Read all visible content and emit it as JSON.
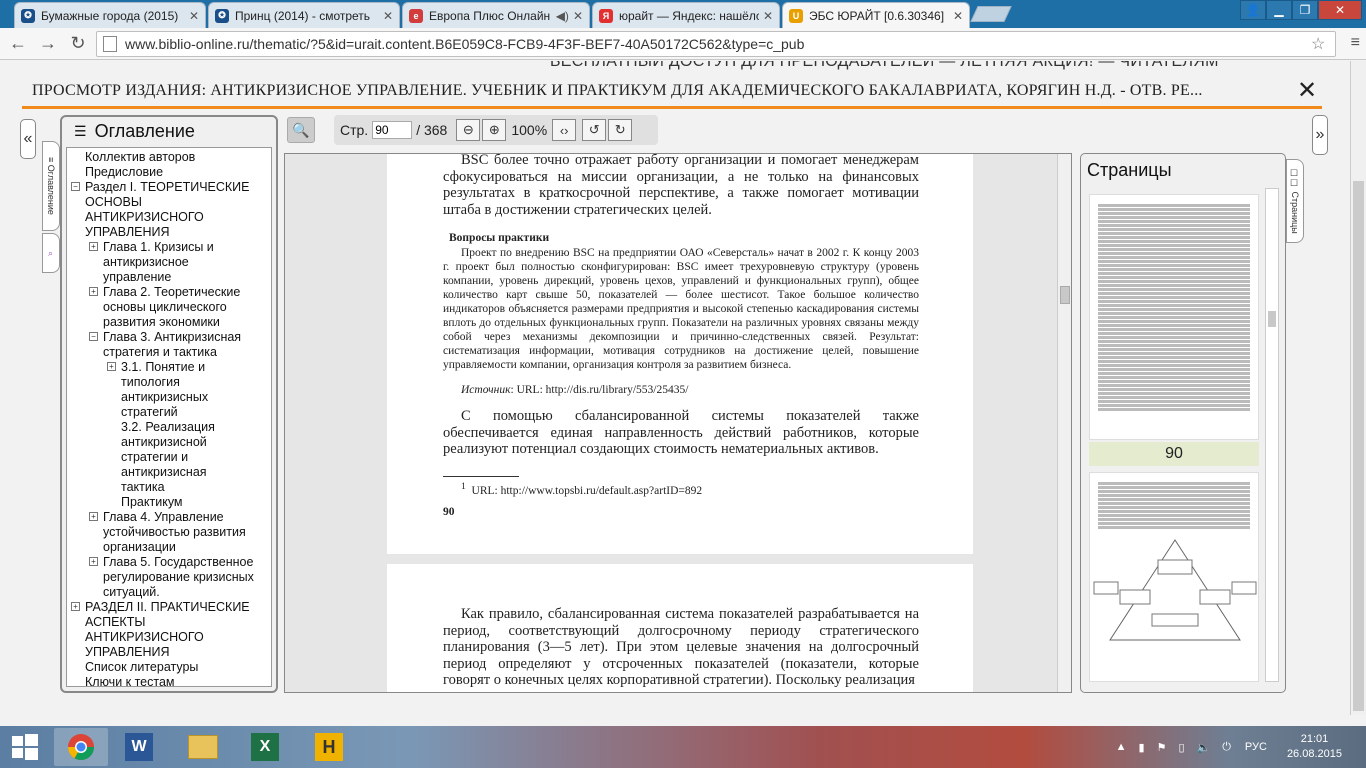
{
  "browser": {
    "tabs": [
      {
        "title": "Бумажные города (2015)",
        "fav_color": "#1b4f8a"
      },
      {
        "title": "Принц (2014) - смотреть",
        "fav_color": "#1b4f8a"
      },
      {
        "title": "Европа Плюс Онлайн",
        "fav_color": "#d33c3c"
      },
      {
        "title": "юрайт — Яндекс: нашёлс",
        "fav_color": "#e23030"
      },
      {
        "title": "ЭБС ЮРАЙТ [0.6.30346]",
        "fav_color": "#e8a000"
      }
    ],
    "url": "www.biblio-online.ru/thematic/?5&id=urait.content.B6E059C8-FCB9-4F3F-BEF7-40A50172C562&type=c_pub"
  },
  "page": {
    "banner": "БЕСПЛАТНЫЙ ДОСТУП ДЛЯ ПРЕПОДАВАТЕЛЕЙ — ЛЕТНЯЯ АКЦИЯ! — ЧИТАТЕЛЯМ",
    "title": "ПРОСМОТР ИЗДАНИЯ: АНТИКРИЗИСНОЕ УПРАВЛЕНИЕ. УЧЕБНИК И ПРАКТИКУМ ДЛЯ АКАДЕМИЧЕСКОГО БАКАЛАВРИАТА, КОРЯГИН Н.Д. - ОТВ. РЕ...",
    "close_label": "✕",
    "left_tab_label": "≡ Оглавление",
    "right_tab_label": "☐☐ Страницы"
  },
  "toc": {
    "title": "Оглавление",
    "items": [
      "Коллектив авторов",
      "Предисловие",
      "Раздел I. ТЕОРЕТИЧЕСКИЕ ОСНОВЫ АНТИКРИЗИСНОГО УПРАВЛЕНИЯ",
      "Глава 1. Кризисы и антикризисное управление",
      "Глава 2. Теоретические основы циклического развития экономики",
      "Глава 3. Антикризисная стратегия и тактика",
      "3.1. Понятие и типология антикризисных стратегий",
      "3.2. Реализация антикризисной стратегии и антикризисная тактика",
      "Практикум",
      "Глава 4. Управление устойчивостью развития организации",
      "Глава 5. Государственное регулирование кризисных ситуаций.",
      "РАЗДЕЛ II. ПРАКТИЧЕСКИЕ АСПЕКТЫ АНТИКРИЗИСНОГО УПРАВЛЕНИЯ",
      "Список литературы",
      "Ключи к тестам"
    ]
  },
  "viewer": {
    "page_label": "Стр.",
    "page_value": "90",
    "page_total": "/ 368",
    "zoom": "100%"
  },
  "document": {
    "p1": "BSC более точно отражает работу организации и помогает менеджерам сфокусироваться на миссии организации, а не только на финансовых результатах в краткосрочной перспективе, а также помогает мотивации штаба в достижении стратегических целей.",
    "q_title": "Вопросы практики",
    "q_text": "Проект по внедрению BSC на предприятии ОАО «Северсталь» начат в 2002 г. К концу 2003 г. проект был полностью сконфигурирован: BSC имеет трехуровневую структуру (уровень компании, уровень дирекций, уровень цехов, управлений и функциональных групп), общее количество карт свыше 50, показателей — более шестисот. Такое большое количество индикаторов объясняется размерами предприятия и высокой степенью каскадирования системы вплоть до отдельных функциональных групп. Показатели на различных уровнях связаны между собой через механизмы декомпозиции и причинно-следственных связей. Результат: систематизация информации, мотивация сотрудников на достижение целей, повышение управляемости компании, организация контроля за развитием бизнеса.",
    "source_label": "Источник",
    "source_text": ": URL: http://dis.ru/library/553/25435/",
    "p2": "С помощью сбалансированной системы показателей также обеспечивается единая направленность действий работников, которые реализуют потенциал создающих стоимость нематериальных активов.",
    "footnote": "URL: http://www.topsbi.ru/default.asp?artID=892",
    "footnote_num": "1",
    "page_num": "90",
    "p3": "Как правило, сбалансированная система показателей разрабатывается на период, соответствующий долгосрочному периоду стратегического планирования (3—5 лет). При этом целевые значения на долгосрочный период определяют у отсроченных показателей (показатели, которые говорят о конечных целях корпоративной стратегии). Поскольку реализация"
  },
  "pages_panel": {
    "title": "Страницы",
    "current": "90"
  },
  "taskbar": {
    "lang": "РУС",
    "time": "21:01",
    "date": "26.08.2015"
  }
}
